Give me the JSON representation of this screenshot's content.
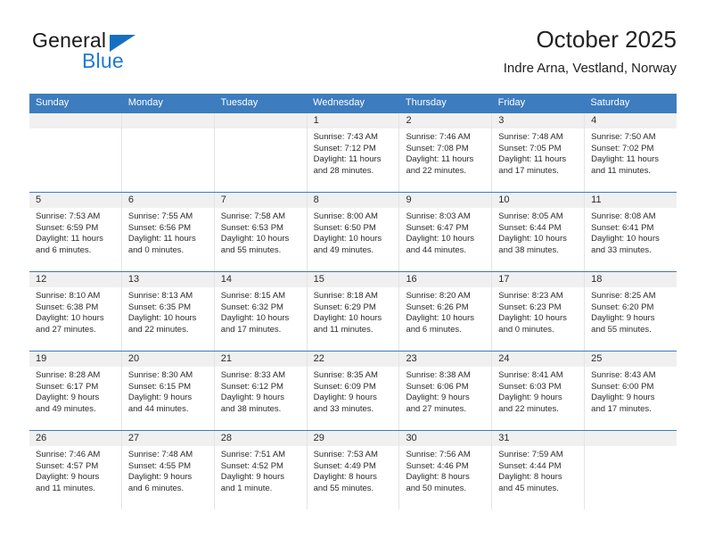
{
  "brand": {
    "name_top": "General",
    "name_bottom": "Blue",
    "accent_color": "#1f7ad4",
    "triangle_color": "#176fc1"
  },
  "header": {
    "title": "October 2025",
    "subtitle": "Indre Arna, Vestland, Norway",
    "header_bg": "#3d7cbf",
    "day_band_bg": "#f0f0f0"
  },
  "weekdays": [
    "Sunday",
    "Monday",
    "Tuesday",
    "Wednesday",
    "Thursday",
    "Friday",
    "Saturday"
  ],
  "weeks": [
    [
      {
        "day": "",
        "sunrise": "",
        "sunset": "",
        "daylight1": "",
        "daylight2": ""
      },
      {
        "day": "",
        "sunrise": "",
        "sunset": "",
        "daylight1": "",
        "daylight2": ""
      },
      {
        "day": "",
        "sunrise": "",
        "sunset": "",
        "daylight1": "",
        "daylight2": ""
      },
      {
        "day": "1",
        "sunrise": "Sunrise: 7:43 AM",
        "sunset": "Sunset: 7:12 PM",
        "daylight1": "Daylight: 11 hours",
        "daylight2": "and 28 minutes."
      },
      {
        "day": "2",
        "sunrise": "Sunrise: 7:46 AM",
        "sunset": "Sunset: 7:08 PM",
        "daylight1": "Daylight: 11 hours",
        "daylight2": "and 22 minutes."
      },
      {
        "day": "3",
        "sunrise": "Sunrise: 7:48 AM",
        "sunset": "Sunset: 7:05 PM",
        "daylight1": "Daylight: 11 hours",
        "daylight2": "and 17 minutes."
      },
      {
        "day": "4",
        "sunrise": "Sunrise: 7:50 AM",
        "sunset": "Sunset: 7:02 PM",
        "daylight1": "Daylight: 11 hours",
        "daylight2": "and 11 minutes."
      }
    ],
    [
      {
        "day": "5",
        "sunrise": "Sunrise: 7:53 AM",
        "sunset": "Sunset: 6:59 PM",
        "daylight1": "Daylight: 11 hours",
        "daylight2": "and 6 minutes."
      },
      {
        "day": "6",
        "sunrise": "Sunrise: 7:55 AM",
        "sunset": "Sunset: 6:56 PM",
        "daylight1": "Daylight: 11 hours",
        "daylight2": "and 0 minutes."
      },
      {
        "day": "7",
        "sunrise": "Sunrise: 7:58 AM",
        "sunset": "Sunset: 6:53 PM",
        "daylight1": "Daylight: 10 hours",
        "daylight2": "and 55 minutes."
      },
      {
        "day": "8",
        "sunrise": "Sunrise: 8:00 AM",
        "sunset": "Sunset: 6:50 PM",
        "daylight1": "Daylight: 10 hours",
        "daylight2": "and 49 minutes."
      },
      {
        "day": "9",
        "sunrise": "Sunrise: 8:03 AM",
        "sunset": "Sunset: 6:47 PM",
        "daylight1": "Daylight: 10 hours",
        "daylight2": "and 44 minutes."
      },
      {
        "day": "10",
        "sunrise": "Sunrise: 8:05 AM",
        "sunset": "Sunset: 6:44 PM",
        "daylight1": "Daylight: 10 hours",
        "daylight2": "and 38 minutes."
      },
      {
        "day": "11",
        "sunrise": "Sunrise: 8:08 AM",
        "sunset": "Sunset: 6:41 PM",
        "daylight1": "Daylight: 10 hours",
        "daylight2": "and 33 minutes."
      }
    ],
    [
      {
        "day": "12",
        "sunrise": "Sunrise: 8:10 AM",
        "sunset": "Sunset: 6:38 PM",
        "daylight1": "Daylight: 10 hours",
        "daylight2": "and 27 minutes."
      },
      {
        "day": "13",
        "sunrise": "Sunrise: 8:13 AM",
        "sunset": "Sunset: 6:35 PM",
        "daylight1": "Daylight: 10 hours",
        "daylight2": "and 22 minutes."
      },
      {
        "day": "14",
        "sunrise": "Sunrise: 8:15 AM",
        "sunset": "Sunset: 6:32 PM",
        "daylight1": "Daylight: 10 hours",
        "daylight2": "and 17 minutes."
      },
      {
        "day": "15",
        "sunrise": "Sunrise: 8:18 AM",
        "sunset": "Sunset: 6:29 PM",
        "daylight1": "Daylight: 10 hours",
        "daylight2": "and 11 minutes."
      },
      {
        "day": "16",
        "sunrise": "Sunrise: 8:20 AM",
        "sunset": "Sunset: 6:26 PM",
        "daylight1": "Daylight: 10 hours",
        "daylight2": "and 6 minutes."
      },
      {
        "day": "17",
        "sunrise": "Sunrise: 8:23 AM",
        "sunset": "Sunset: 6:23 PM",
        "daylight1": "Daylight: 10 hours",
        "daylight2": "and 0 minutes."
      },
      {
        "day": "18",
        "sunrise": "Sunrise: 8:25 AM",
        "sunset": "Sunset: 6:20 PM",
        "daylight1": "Daylight: 9 hours",
        "daylight2": "and 55 minutes."
      }
    ],
    [
      {
        "day": "19",
        "sunrise": "Sunrise: 8:28 AM",
        "sunset": "Sunset: 6:17 PM",
        "daylight1": "Daylight: 9 hours",
        "daylight2": "and 49 minutes."
      },
      {
        "day": "20",
        "sunrise": "Sunrise: 8:30 AM",
        "sunset": "Sunset: 6:15 PM",
        "daylight1": "Daylight: 9 hours",
        "daylight2": "and 44 minutes."
      },
      {
        "day": "21",
        "sunrise": "Sunrise: 8:33 AM",
        "sunset": "Sunset: 6:12 PM",
        "daylight1": "Daylight: 9 hours",
        "daylight2": "and 38 minutes."
      },
      {
        "day": "22",
        "sunrise": "Sunrise: 8:35 AM",
        "sunset": "Sunset: 6:09 PM",
        "daylight1": "Daylight: 9 hours",
        "daylight2": "and 33 minutes."
      },
      {
        "day": "23",
        "sunrise": "Sunrise: 8:38 AM",
        "sunset": "Sunset: 6:06 PM",
        "daylight1": "Daylight: 9 hours",
        "daylight2": "and 27 minutes."
      },
      {
        "day": "24",
        "sunrise": "Sunrise: 8:41 AM",
        "sunset": "Sunset: 6:03 PM",
        "daylight1": "Daylight: 9 hours",
        "daylight2": "and 22 minutes."
      },
      {
        "day": "25",
        "sunrise": "Sunrise: 8:43 AM",
        "sunset": "Sunset: 6:00 PM",
        "daylight1": "Daylight: 9 hours",
        "daylight2": "and 17 minutes."
      }
    ],
    [
      {
        "day": "26",
        "sunrise": "Sunrise: 7:46 AM",
        "sunset": "Sunset: 4:57 PM",
        "daylight1": "Daylight: 9 hours",
        "daylight2": "and 11 minutes."
      },
      {
        "day": "27",
        "sunrise": "Sunrise: 7:48 AM",
        "sunset": "Sunset: 4:55 PM",
        "daylight1": "Daylight: 9 hours",
        "daylight2": "and 6 minutes."
      },
      {
        "day": "28",
        "sunrise": "Sunrise: 7:51 AM",
        "sunset": "Sunset: 4:52 PM",
        "daylight1": "Daylight: 9 hours",
        "daylight2": "and 1 minute."
      },
      {
        "day": "29",
        "sunrise": "Sunrise: 7:53 AM",
        "sunset": "Sunset: 4:49 PM",
        "daylight1": "Daylight: 8 hours",
        "daylight2": "and 55 minutes."
      },
      {
        "day": "30",
        "sunrise": "Sunrise: 7:56 AM",
        "sunset": "Sunset: 4:46 PM",
        "daylight1": "Daylight: 8 hours",
        "daylight2": "and 50 minutes."
      },
      {
        "day": "31",
        "sunrise": "Sunrise: 7:59 AM",
        "sunset": "Sunset: 4:44 PM",
        "daylight1": "Daylight: 8 hours",
        "daylight2": "and 45 minutes."
      },
      {
        "day": "",
        "sunrise": "",
        "sunset": "",
        "daylight1": "",
        "daylight2": ""
      }
    ]
  ]
}
